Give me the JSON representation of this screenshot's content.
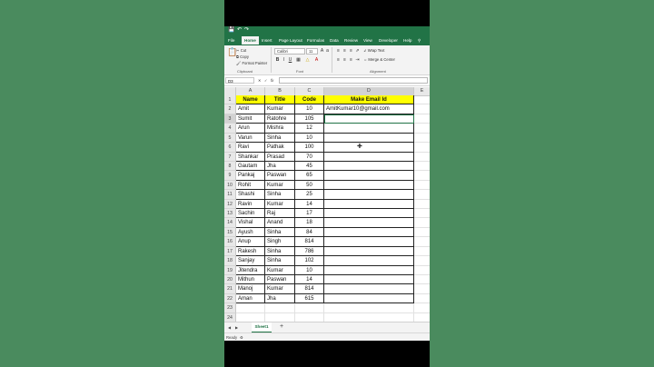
{
  "quick_access": {
    "save_icon": "save-icon",
    "undo_icon": "undo-icon",
    "redo_icon": "redo-icon"
  },
  "menu_tabs": [
    "File",
    "Home",
    "Insert",
    "Page Layout",
    "Formulas",
    "Data",
    "Review",
    "View",
    "Developer",
    "Help"
  ],
  "ribbon": {
    "cut": "Cut",
    "copy": "Copy",
    "format_painter": "Format Painter",
    "clipboard_group": "Clipboard",
    "font_name": "Calibri",
    "font_size": "11",
    "bold": "B",
    "italic": "I",
    "underline": "U",
    "font_group": "Font",
    "wrap_text": "Wrap Text",
    "merge_center": "Merge & Center",
    "alignment_group": "Alignment"
  },
  "formula_bar": {
    "name_box": "D3",
    "fx": "fx"
  },
  "columns": [
    "A",
    "B",
    "C",
    "D",
    "E"
  ],
  "header_row": {
    "a": "Name",
    "b": "Title",
    "c": "Code",
    "d": "Make Email Id"
  },
  "rows": [
    {
      "a": "Amit",
      "b": "Kumar",
      "c": "10",
      "d": "AmitKumar10@gmail.com"
    },
    {
      "a": "Sumit",
      "b": "Ratohre",
      "c": "105",
      "d": ""
    },
    {
      "a": "Arun",
      "b": "Mishra",
      "c": "12",
      "d": ""
    },
    {
      "a": "Varun",
      "b": "Sinha",
      "c": "10",
      "d": ""
    },
    {
      "a": "Ravi",
      "b": "Pathak",
      "c": "100",
      "d": ""
    },
    {
      "a": "Shankar",
      "b": "Prasad",
      "c": "70",
      "d": ""
    },
    {
      "a": "Gautam",
      "b": "Jha",
      "c": "45",
      "d": ""
    },
    {
      "a": "Pankaj",
      "b": "Paswan",
      "c": "65",
      "d": ""
    },
    {
      "a": "Rohit",
      "b": "Kumar",
      "c": "50",
      "d": ""
    },
    {
      "a": "Shashi",
      "b": "Sinha",
      "c": "25",
      "d": ""
    },
    {
      "a": "Ravin",
      "b": "Kumar",
      "c": "14",
      "d": ""
    },
    {
      "a": "Sachin",
      "b": "Raj",
      "c": "17",
      "d": ""
    },
    {
      "a": "Vishal",
      "b": "Anand",
      "c": "18",
      "d": ""
    },
    {
      "a": "Ayush",
      "b": "Sinha",
      "c": "84",
      "d": ""
    },
    {
      "a": "Anup",
      "b": "Singh",
      "c": "814",
      "d": ""
    },
    {
      "a": "Rakesh",
      "b": "Sinha",
      "c": "786",
      "d": ""
    },
    {
      "a": "Sanjay",
      "b": "Sinha",
      "c": "102",
      "d": ""
    },
    {
      "a": "Jitendra",
      "b": "Kumar",
      "c": "10",
      "d": ""
    },
    {
      "a": "Mithun",
      "b": "Paswan",
      "c": "14",
      "d": ""
    },
    {
      "a": "Manoj",
      "b": "Kumar",
      "c": "814",
      "d": ""
    },
    {
      "a": "Aman",
      "b": "Jha",
      "c": "615",
      "d": ""
    }
  ],
  "empty_rows": [
    "23",
    "24"
  ],
  "sheet": {
    "name": "Sheet1",
    "add_label": "+"
  },
  "status": {
    "ready": "Ready"
  },
  "theme": {
    "excel_green": "#217346",
    "header_yellow": "#ffff00",
    "background_green": "#4a8b5e"
  }
}
